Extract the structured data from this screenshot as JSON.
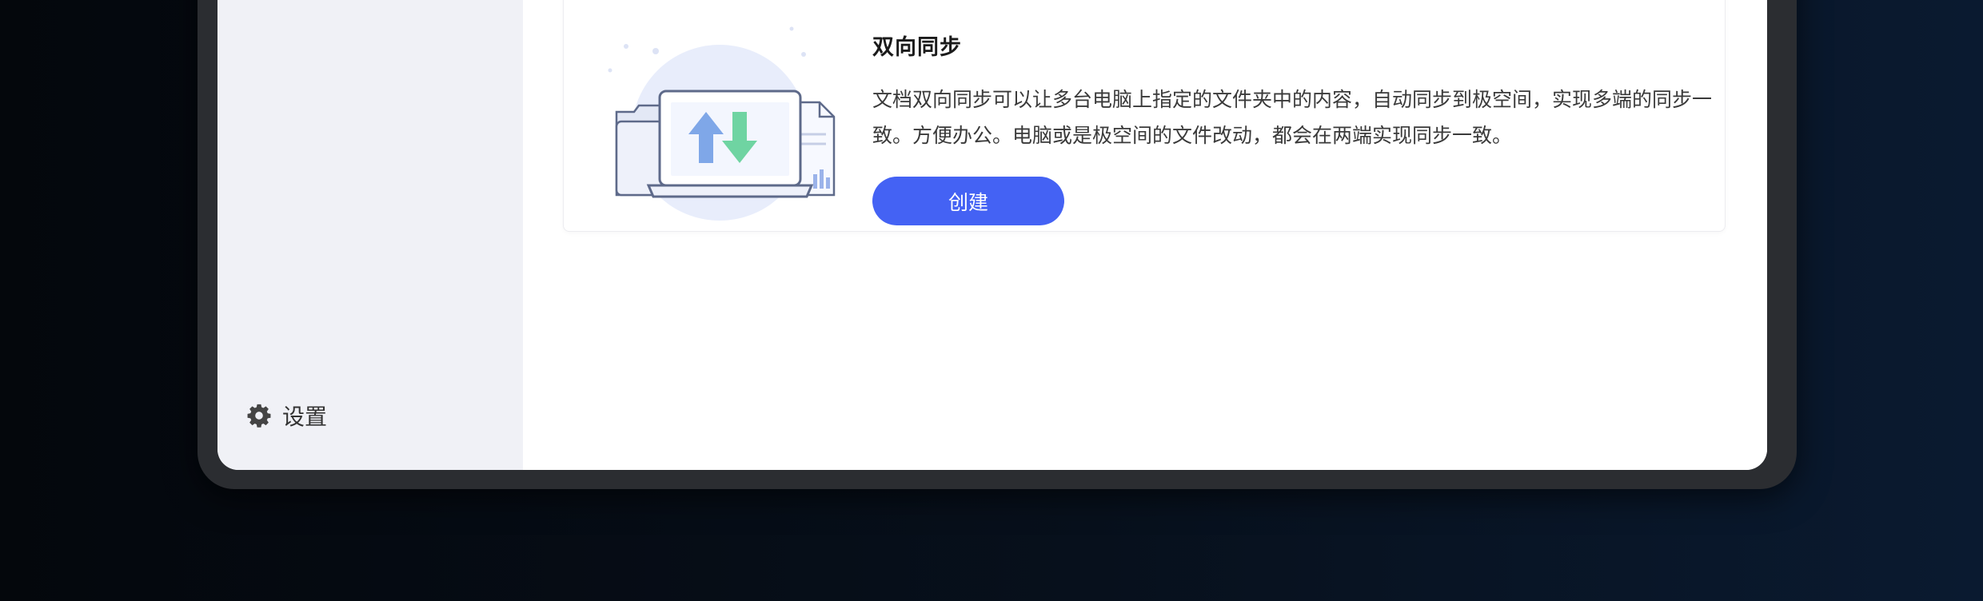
{
  "sidebar": {
    "settings": {
      "label": "设置",
      "icon": "gear-icon"
    }
  },
  "card": {
    "title": "双向同步",
    "description": "文档双向同步可以让多台电脑上指定的文件夹中的内容，自动同步到极空间，实现多端的同步一致。方便办公。电脑或是极空间的文件改动，都会在两端实现同步一致。",
    "create_label": "创建",
    "illustration": "laptop-sync-illustration"
  },
  "colors": {
    "accent": "#4462f4",
    "sidebar_bg": "#f0f1f6",
    "upload_arrow": "#7fa7e8",
    "download_arrow": "#6fd4a2",
    "device_frame": "#2b2d31"
  }
}
